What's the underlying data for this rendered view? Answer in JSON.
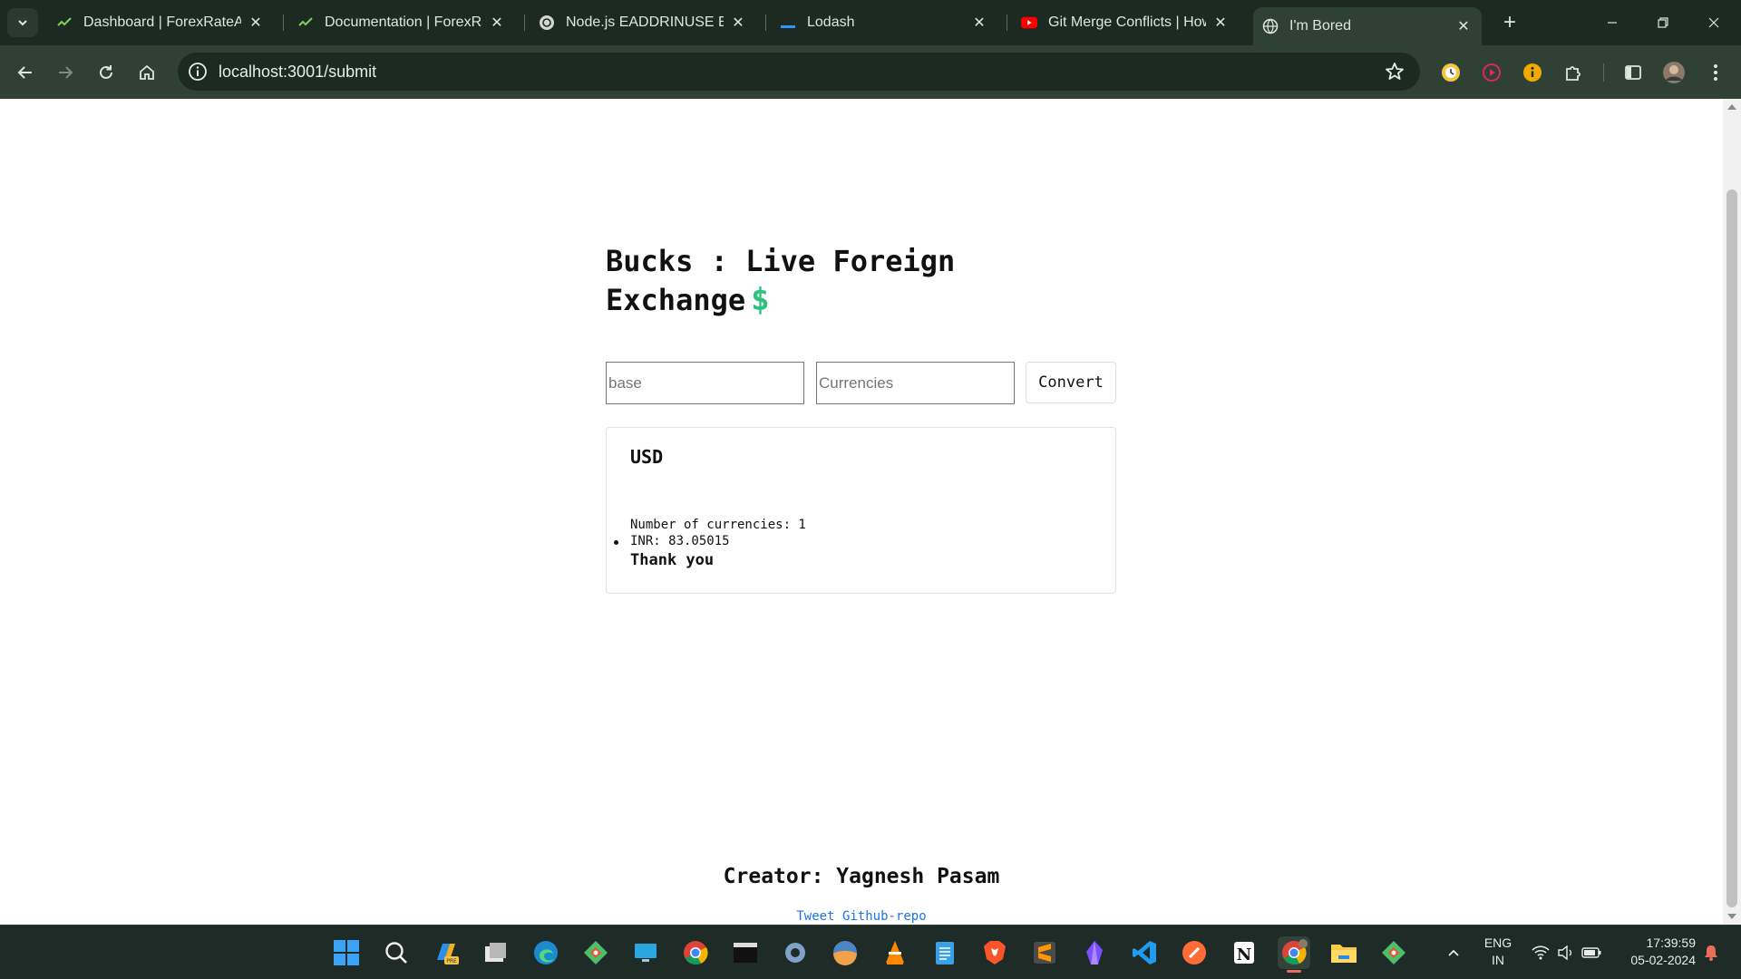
{
  "browser": {
    "tabs": [
      {
        "title": "Dashboard | ForexRateAPI",
        "favicon": "check-icon",
        "active": false
      },
      {
        "title": "Documentation | ForexRateAPI",
        "favicon": "check-icon",
        "active": false
      },
      {
        "title": "Node.js EADDRINUSE Error",
        "favicon": "openai-icon",
        "active": false
      },
      {
        "title": "Lodash",
        "favicon": "lodash-icon",
        "active": false
      },
      {
        "title": "Git Merge Conflicts | How to",
        "favicon": "youtube-icon",
        "active": false
      },
      {
        "title": "I'm Bored",
        "favicon": "globe-icon",
        "active": true
      }
    ],
    "url": "localhost:3001/submit",
    "theme": {
      "frame": "#1c2a22",
      "toolbar": "#2f4034"
    }
  },
  "page": {
    "heading_line1": "Bucks : Live Foreign",
    "heading_line2": "Exchange",
    "heading_symbol": "$",
    "base_placeholder": "base",
    "currencies_placeholder": "Currencies",
    "convert_label": "Convert",
    "result": {
      "base": "USD",
      "count_text": "Number of currencies: 1",
      "rates": [
        "INR: 83.05015"
      ],
      "thanks": "Thank you"
    },
    "footer": {
      "creator": "Creator: Yagnesh Pasam",
      "tweet_label": "Tweet",
      "github_label": "Github-repo"
    },
    "accent_color": "#2ec27e",
    "link_color": "#1a73e8"
  },
  "taskbar": {
    "apps": [
      "start-icon",
      "search-icon",
      "copilot-icon",
      "task-view-icon",
      "edge-icon",
      "git-icon",
      "remote-desktop-icon",
      "chrome-icon",
      "terminal-icon",
      "settings-icon",
      "weather-icon",
      "vlc-icon",
      "notepad-icon",
      "brave-icon",
      "sublime-text-icon",
      "obsidian-icon",
      "vscode-icon",
      "postman-icon",
      "notion-icon",
      "chrome-icon",
      "file-explorer-icon",
      "git-icon"
    ],
    "lang_line1": "ENG",
    "lang_line2": "IN",
    "time": "17:39:59",
    "date": "05-02-2024"
  }
}
